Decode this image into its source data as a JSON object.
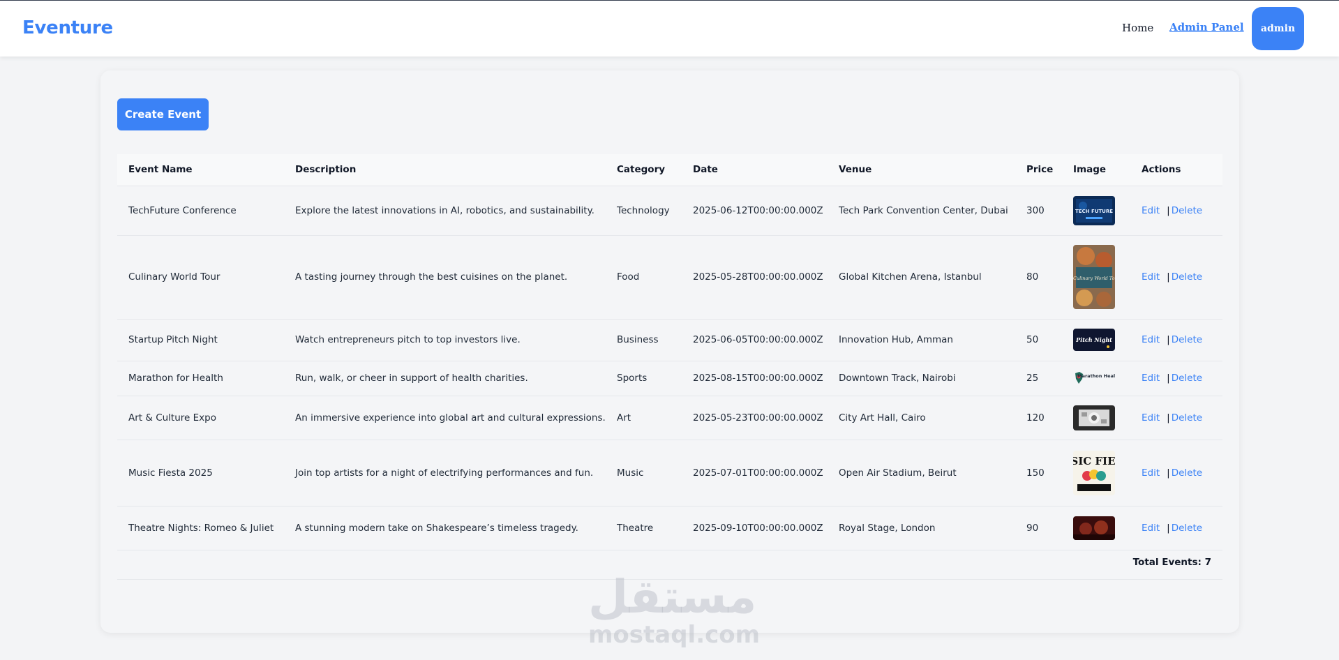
{
  "navbar": {
    "brand": "Eventure",
    "home_label": "Home",
    "admin_label": "Admin Panel",
    "user_label": "admin"
  },
  "toolbar": {
    "create_label": "Create Event"
  },
  "table": {
    "headers": [
      "Event Name",
      "Description",
      "Category",
      "Date",
      "Venue",
      "Price",
      "Image",
      "Actions"
    ],
    "edit_label": "Edit",
    "delete_label": "Delete",
    "separator": "|",
    "rows": [
      {
        "name": "TechFuture Conference",
        "description": "Explore the latest innovations in AI, robotics, and sustainability.",
        "category": "Technology",
        "date": "2025-06-12T00:00:00.000Z",
        "venue": "Tech Park Convention Center, Dubai",
        "price": "300",
        "thumb_text": "TECH FUTURE"
      },
      {
        "name": "Culinary World Tour",
        "description": "A tasting journey through the best cuisines on the planet.",
        "category": "Food",
        "date": "2025-05-28T00:00:00.000Z",
        "venue": "Global Kitchen Arena, Istanbul",
        "price": "80",
        "thumb_text": "A Culinary World Tour"
      },
      {
        "name": "Startup Pitch Night",
        "description": "Watch entrepreneurs pitch to top investors live.",
        "category": "Business",
        "date": "2025-06-05T00:00:00.000Z",
        "venue": "Innovation Hub, Amman",
        "price": "50",
        "thumb_text": "Pitch Night"
      },
      {
        "name": "Marathon for Health",
        "description": "Run, walk, or cheer in support of health charities.",
        "category": "Sports",
        "date": "2025-08-15T00:00:00.000Z",
        "venue": "Downtown Track, Nairobi",
        "price": "25",
        "thumb_text": "Marathon Health"
      },
      {
        "name": "Art & Culture Expo",
        "description": "An immersive experience into global art and cultural expressions.",
        "category": "Art",
        "date": "2025-05-23T00:00:00.000Z",
        "venue": "City Art Hall, Cairo",
        "price": "120",
        "thumb_text": ""
      },
      {
        "name": "Music Fiesta 2025",
        "description": "Join top artists for a night of electrifying performances and fun.",
        "category": "Music",
        "date": "2025-07-01T00:00:00.000Z",
        "venue": "Open Air Stadium, Beirut",
        "price": "150",
        "thumb_text": "MUSIC FIESTA"
      },
      {
        "name": "Theatre Nights: Romeo & Juliet",
        "description": "A stunning modern take on Shakespeare’s timeless tragedy.",
        "category": "Theatre",
        "date": "2025-09-10T00:00:00.000Z",
        "venue": "Royal Stage, London",
        "price": "90",
        "thumb_text": ""
      }
    ]
  },
  "footer": {
    "total_label": "Total Events: 7"
  },
  "watermark": {
    "arabic": "مستقل",
    "latin": "mostaql.com"
  },
  "colors": {
    "accent": "#3b82f6",
    "background": "#f3f4f6"
  }
}
